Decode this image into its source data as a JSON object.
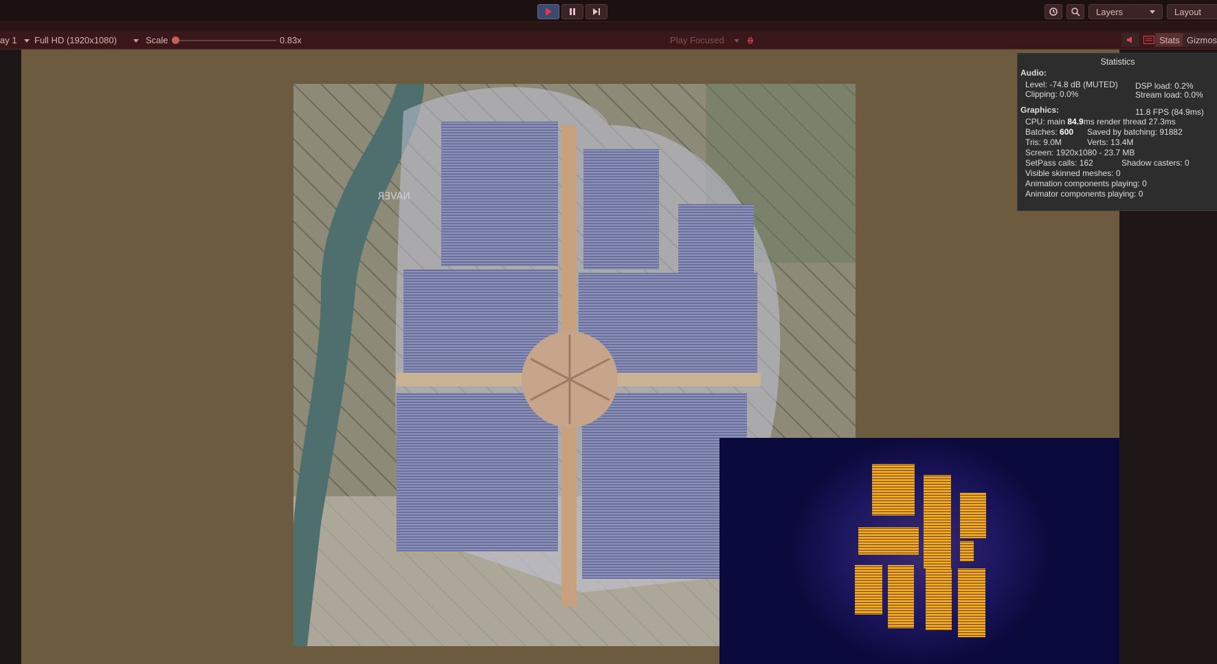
{
  "toolbar": {
    "layers_label": "Layers",
    "layout_label": "Layout"
  },
  "game_bar": {
    "display_label": "ay 1",
    "resolution_label": "Full HD (1920x1080)",
    "scale_label": "Scale",
    "scale_value": "0.83x",
    "play_mode_label": "Play Focused",
    "stats_label": "Stats",
    "gizmos_label": "Gizmos"
  },
  "map": {
    "watermark": "NAVER"
  },
  "stats": {
    "title": "Statistics",
    "audio_header": "Audio:",
    "audio_level": "Level: -74.8 dB (MUTED)",
    "dsp_load": "DSP load: 0.2%",
    "clipping": "Clipping: 0.0%",
    "stream_load": "Stream load: 0.0%",
    "graphics_header": "Graphics:",
    "fps": "11.8 FPS (84.9ms)",
    "cpu_prefix": "CPU: main ",
    "cpu_main": "84.9",
    "cpu_suffix": "ms  render thread 27.3ms",
    "batches_prefix": "Batches: ",
    "batches": "600",
    "saved_batching": "Saved by batching: 91882",
    "tris": "Tris: 9.0M",
    "verts": "Verts: 13.4M",
    "screen": "Screen: 1920x1080 - 23.7 MB",
    "setpass": "SetPass calls: 162",
    "shadow_casters": "Shadow casters: 0",
    "skinned_meshes": "Visible skinned meshes: 0",
    "animation_components": "Animation components playing: 0",
    "animator_components": "Animator components playing: 0"
  },
  "colors": {
    "editor_bg": "#1c1010",
    "game_bar": "#3a1718",
    "viewport_bg": "#6d5b3f",
    "heatmap_bg": "#0b0a3d",
    "heat_cell": "#f2a81d",
    "panel_tint": "#a3abd6"
  }
}
